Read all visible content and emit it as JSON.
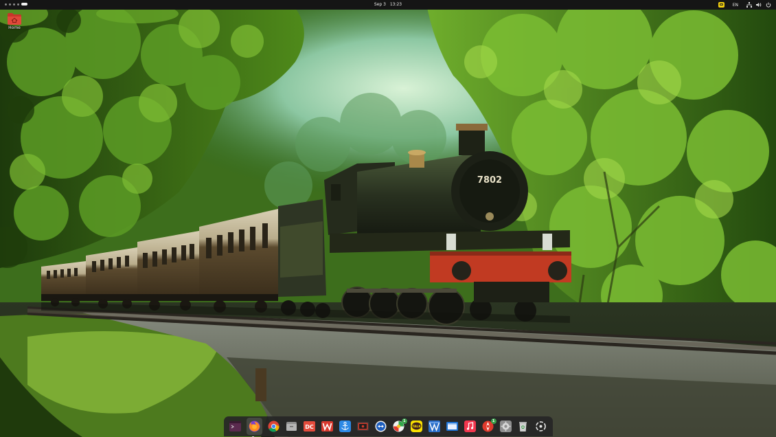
{
  "topbar": {
    "clock_date": "Sep 3",
    "clock_time": "13:23",
    "language": "EN",
    "icons": [
      "keyboard-layout-icon",
      "network-icon",
      "volume-icon",
      "power-icon"
    ]
  },
  "desktop": {
    "icons": [
      {
        "label": "Home",
        "icon": "home-folder-icon"
      }
    ],
    "wallpaper": {
      "locomotive_number": "7802"
    }
  },
  "dock": {
    "apps": [
      {
        "name": "terminal",
        "icon": "terminal-icon",
        "running": false
      },
      {
        "name": "firefox",
        "icon": "firefox-icon",
        "running": true
      },
      {
        "name": "chrome",
        "icon": "chrome-icon",
        "running": false
      },
      {
        "name": "files",
        "icon": "files-icon",
        "running": false
      },
      {
        "name": "dc",
        "icon": "dc-icon",
        "running": false
      },
      {
        "name": "wps-office",
        "icon": "wps-icon",
        "running": false
      },
      {
        "name": "anchor-app",
        "icon": "anchor-app-icon",
        "running": false
      },
      {
        "name": "screen-recorder",
        "icon": "screen-recorder-icon",
        "running": false
      },
      {
        "name": "remote-desktop",
        "icon": "remote-desktop-icon",
        "running": false
      },
      {
        "name": "whatsapp",
        "icon": "whatsapp-icon",
        "running": false,
        "badge": "1"
      },
      {
        "name": "kakaotalk",
        "icon": "kakaotalk-icon",
        "running": false,
        "label": "TALK"
      },
      {
        "name": "vpn",
        "icon": "vpn-icon",
        "running": false
      },
      {
        "name": "window-manager",
        "icon": "window-icon",
        "running": false
      },
      {
        "name": "music",
        "icon": "music-icon",
        "running": false
      },
      {
        "name": "mail",
        "icon": "mail-icon",
        "running": false,
        "badge": "1"
      },
      {
        "name": "settings",
        "icon": "settings-icon",
        "running": false
      },
      {
        "name": "trash",
        "icon": "trash-icon",
        "running": false
      },
      {
        "name": "show-apps",
        "icon": "app-grid-icon",
        "running": false
      }
    ]
  },
  "colors": {
    "topbar_bg": "#151515",
    "dock_bg": "#262626",
    "home_folder": "#e0483a",
    "loco_buffer_beam": "#c13a22"
  }
}
